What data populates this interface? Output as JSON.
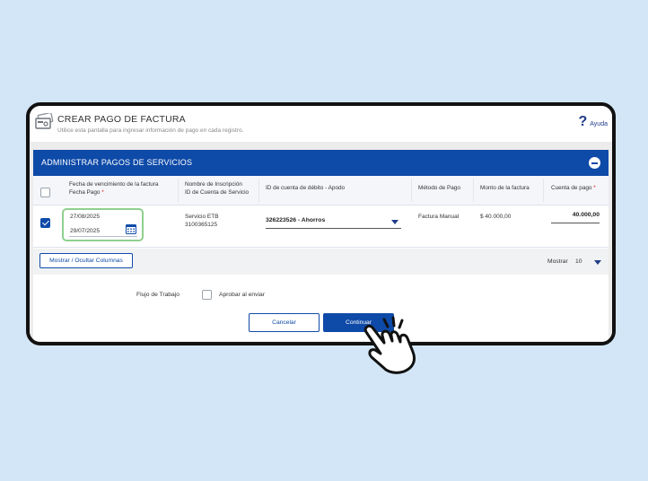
{
  "header": {
    "title": "CREAR PAGO DE FACTURA",
    "subtitle": "Utilice esta pantalla para ingresar información de pago en cada registro.",
    "help_label": "Ayuda",
    "help_symbol": "?"
  },
  "section": {
    "title": "ADMINISTRAR PAGOS DE SERVICIOS"
  },
  "table": {
    "columns": {
      "due_date": "Fecha de vencimiento de la factura",
      "pay_date": "Fecha Pago",
      "registration_name": "Nombre de Inscripción",
      "service_account_id": "ID de Cuenta de Servicio",
      "debit_account": "ID de cuenta de débito - Apodo",
      "payment_method": "Método de Pago",
      "invoice_amount": "Monto de la factura",
      "payment_amount": "Cuenta de pago",
      "required_mark": "*"
    },
    "rows": [
      {
        "selected": true,
        "due_date": "27/08/2025",
        "pay_date": "29/07/2025",
        "registration_name": "Servicio ETB",
        "service_account_id": "3100365125",
        "debit_account": "326223526 - Ahorros",
        "payment_method": "Factura Manual",
        "invoice_amount": "$ 40.000,00",
        "payment_amount": "40.000,00"
      }
    ]
  },
  "toolbar": {
    "columns_button": "Mostrar / Ocultar Columnas",
    "show_label": "Mostrar",
    "show_value": "10"
  },
  "workflow": {
    "label": "Flujo de Trabajo",
    "approve_label": "Aprobar al enviar",
    "approve_checked": false
  },
  "actions": {
    "cancel": "Cancelar",
    "continue": "Continuar"
  },
  "colors": {
    "brand": "#0e4aa8",
    "highlight": "#8fd08f",
    "background": "#d3e6f7"
  },
  "icons": [
    "bill-payment-icon",
    "help-icon",
    "collapse-icon",
    "calendar-icon",
    "dropdown-caret-icon",
    "pointer-hand-icon"
  ]
}
